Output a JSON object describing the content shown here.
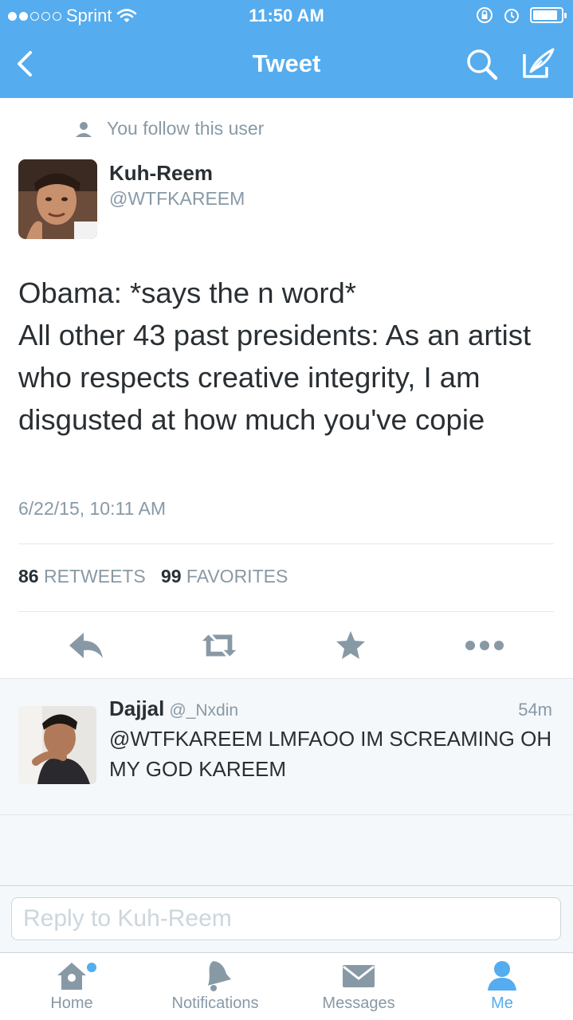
{
  "status_bar": {
    "carrier": "Sprint",
    "time": "11:50 AM",
    "signal_icon": "signal-dots-icon",
    "wifi_icon": "wifi-icon",
    "battery_level": 0.9
  },
  "navbar": {
    "title": "Tweet",
    "back_icon": "chevron-left-icon",
    "search_icon": "search-icon",
    "compose_icon": "compose-icon"
  },
  "tweet": {
    "follow_notice": "You follow this user",
    "author_name": "Kuh-Reem",
    "author_handle": "@WTFKAREEM",
    "text": "Obama: *says the n word*\nAll other 43 past presidents: As an artist who respects creative integrity, I am disgusted at how much you've copie",
    "date": "6/22/15, 10:11 AM",
    "retweets_count": "86",
    "retweets_label": "RETWEETS",
    "favorites_count": "99",
    "favorites_label": "FAVORITES"
  },
  "reply": {
    "name": "Dajjal",
    "handle": "@_Nxdin",
    "time": "54m",
    "text": "@WTFKAREEM LMFAOO IM SCREAMING OH MY GOD KAREEM"
  },
  "compose": {
    "placeholder": "Reply to Kuh-Reem"
  },
  "tabbar": {
    "tabs": [
      {
        "label": "Home",
        "icon": "home-icon"
      },
      {
        "label": "Notifications",
        "icon": "bell-icon"
      },
      {
        "label": "Messages",
        "icon": "envelope-icon"
      },
      {
        "label": "Me",
        "icon": "person-icon"
      }
    ],
    "active": "Me"
  },
  "colors": {
    "brand": "#55acee",
    "text_primary": "#292f33",
    "text_secondary": "#8899a6",
    "divider": "#e1e8ed"
  }
}
